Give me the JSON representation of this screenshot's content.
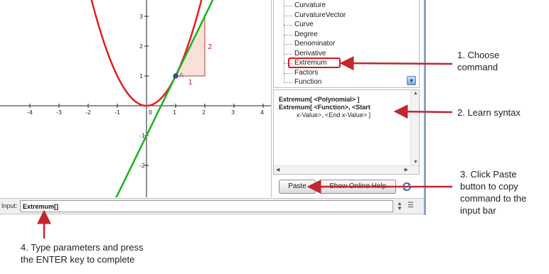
{
  "graphics": {
    "x_ticks": [
      "-4",
      "-3",
      "-2",
      "-1",
      "0",
      "1",
      "2",
      "3",
      "4"
    ],
    "y_ticks": [
      "3",
      "2",
      "1",
      "-1",
      "-2"
    ],
    "point_label": "A",
    "slope_run_label": "1",
    "slope_rise_label": "2",
    "colors": {
      "parabola": "#e51c23",
      "tangent": "#19b31b",
      "slope_fill": "#f8e1d8",
      "slope_stroke": "#c0392b",
      "point": "#4a4af0"
    }
  },
  "command_list": {
    "items": [
      "Curvature",
      "CurvatureVector",
      "Curve",
      "Degree",
      "Denominator",
      "Derivative",
      "Extremum",
      "Factors",
      "Function"
    ],
    "selected": "Extremum"
  },
  "syntax": {
    "line1": "Extremum[ <Polynomial> ]",
    "line2": "Extremum[ <Function>, <Start",
    "line3": "          x-Value>, <End x-Value> ]"
  },
  "buttons": {
    "paste": "Paste",
    "help": "Show Online Help"
  },
  "input_bar": {
    "label": "Input:",
    "value": "Extremum[]"
  },
  "annotations": {
    "step1": "1. Choose\ncommand",
    "step2": "2. Learn syntax",
    "step3": "3. Click Paste\nbutton to copy\ncommand to the\ninput bar",
    "step4": "4. Type parameters and press\nthe ENTER key to complete",
    "arrow_color": "#c1272d"
  }
}
